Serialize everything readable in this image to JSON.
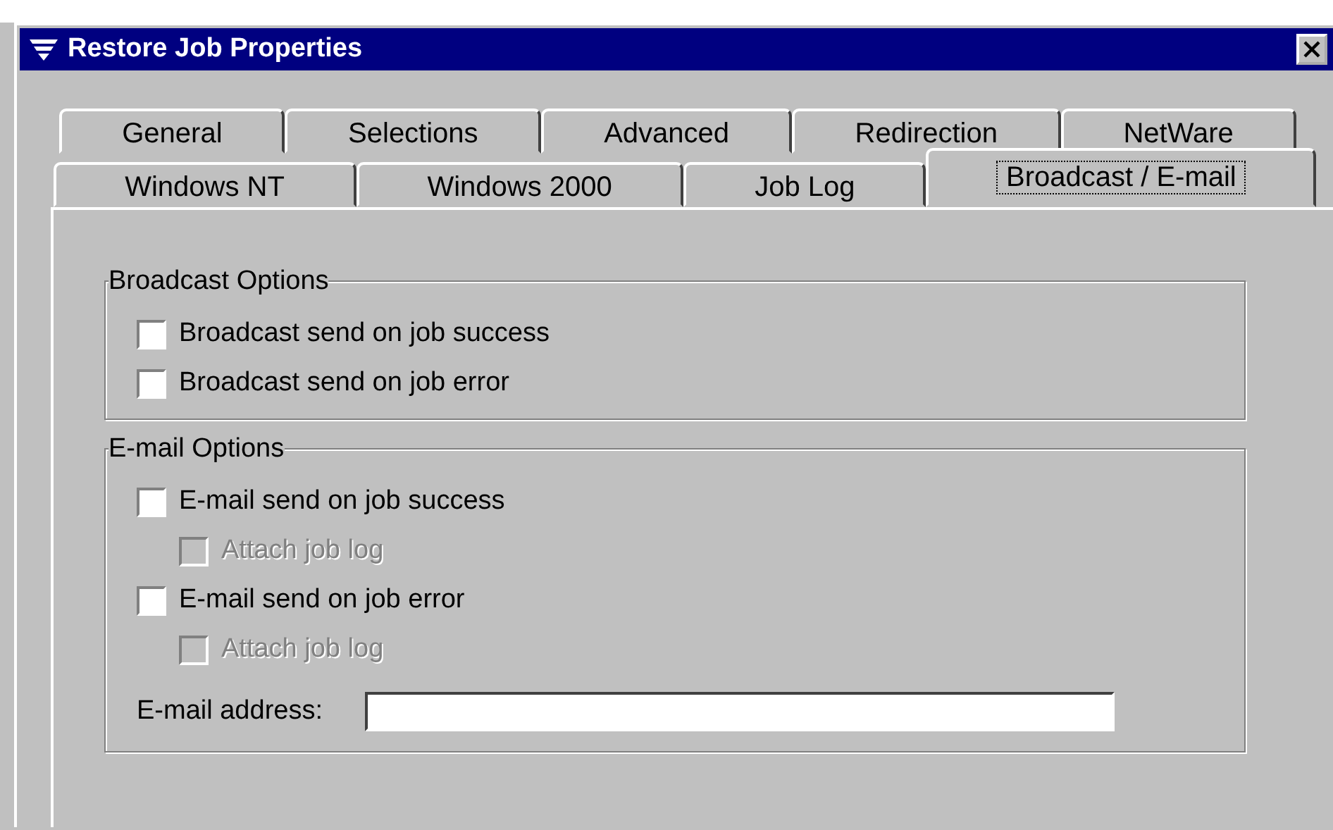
{
  "window": {
    "title": "Restore Job Properties"
  },
  "tab_rows": [
    [
      {
        "label": "General",
        "selected": false
      },
      {
        "label": "Selections",
        "selected": false
      },
      {
        "label": "Advanced",
        "selected": false
      },
      {
        "label": "Redirection",
        "selected": false
      },
      {
        "label": "NetWare",
        "selected": false
      }
    ],
    [
      {
        "label": "Windows NT",
        "selected": false
      },
      {
        "label": "Windows 2000",
        "selected": false
      },
      {
        "label": "Job Log",
        "selected": false
      },
      {
        "label": "Broadcast / E-mail",
        "selected": true
      }
    ]
  ],
  "groups": [
    {
      "title": "Broadcast Options",
      "options": [
        {
          "label": "Broadcast send on job success",
          "checked": false,
          "disabled": false
        },
        {
          "label": "Broadcast send on job error",
          "checked": false,
          "disabled": false
        }
      ]
    },
    {
      "title": "E-mail Options",
      "options": [
        {
          "label": "E-mail send on job success",
          "checked": false,
          "disabled": false,
          "children": [
            {
              "label": "Attach job log",
              "checked": false,
              "disabled": true
            }
          ]
        },
        {
          "label": "E-mail send on job error",
          "checked": false,
          "disabled": false,
          "children": [
            {
              "label": "Attach job log",
              "checked": false,
              "disabled": true
            }
          ]
        }
      ],
      "field": {
        "label": "E-mail address:"
      }
    }
  ]
}
